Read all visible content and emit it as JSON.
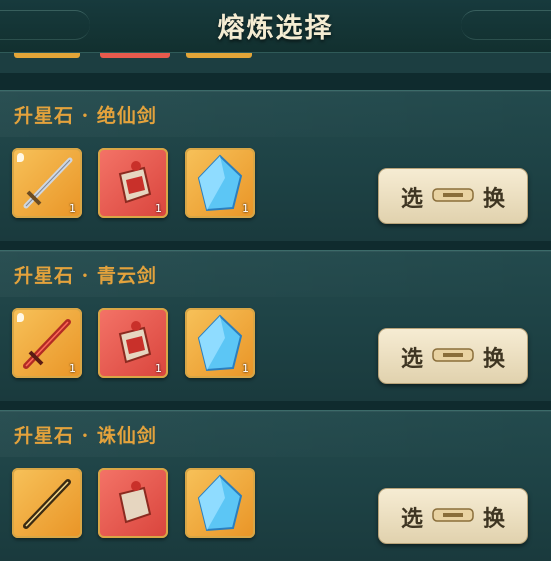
{
  "header": {
    "title": "熔炼选择"
  },
  "cards": [
    {
      "title": "升星石 · 绝仙剑",
      "items": [
        {
          "icon": "sword-icon",
          "count": "1"
        },
        {
          "icon": "red-bag-icon",
          "count": "1"
        },
        {
          "icon": "blue-crystal-icon",
          "count": "1"
        }
      ],
      "button": {
        "left": "选",
        "right": "换",
        "icon": "key-icon"
      }
    },
    {
      "title": "升星石 · 青云剑",
      "items": [
        {
          "icon": "red-sword-icon",
          "count": "1"
        },
        {
          "icon": "red-bag-icon",
          "count": "1"
        },
        {
          "icon": "blue-crystal-icon",
          "count": "1"
        }
      ],
      "button": {
        "left": "选",
        "right": "换",
        "icon": "key-icon"
      }
    },
    {
      "title": "升星石 · 诛仙剑",
      "items": [
        {
          "icon": "sword-icon",
          "count": ""
        },
        {
          "icon": "red-bag-icon",
          "count": ""
        },
        {
          "icon": "blue-crystal-icon",
          "count": ""
        }
      ],
      "button": {
        "left": "选",
        "right": "换",
        "icon": "key-icon"
      }
    }
  ]
}
